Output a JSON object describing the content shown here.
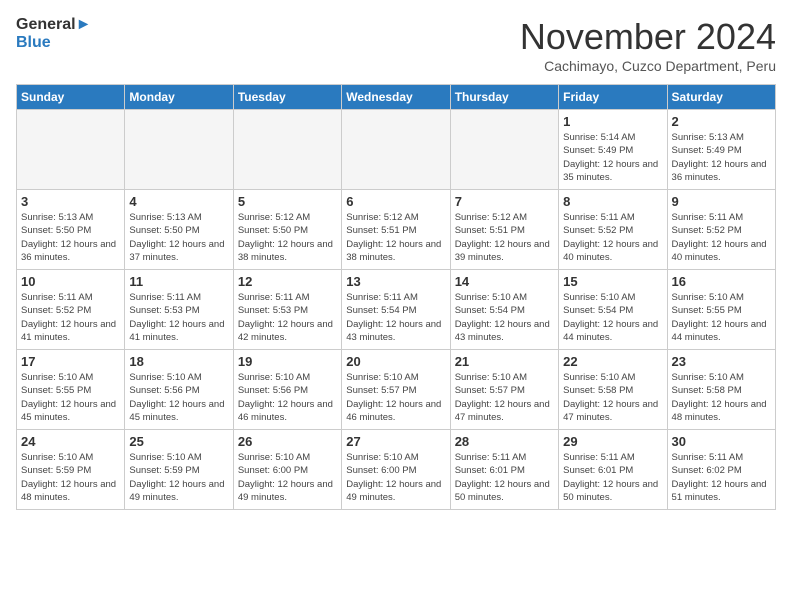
{
  "header": {
    "logo_line1": "General",
    "logo_line2": "Blue",
    "month": "November 2024",
    "location": "Cachimayo, Cuzco Department, Peru"
  },
  "days_of_week": [
    "Sunday",
    "Monday",
    "Tuesday",
    "Wednesday",
    "Thursday",
    "Friday",
    "Saturday"
  ],
  "weeks": [
    [
      {
        "day": "",
        "empty": true
      },
      {
        "day": "",
        "empty": true
      },
      {
        "day": "",
        "empty": true
      },
      {
        "day": "",
        "empty": true
      },
      {
        "day": "",
        "empty": true
      },
      {
        "day": "1",
        "sunrise": "5:14 AM",
        "sunset": "5:49 PM",
        "daylight": "12 hours and 35 minutes."
      },
      {
        "day": "2",
        "sunrise": "5:13 AM",
        "sunset": "5:49 PM",
        "daylight": "12 hours and 36 minutes."
      }
    ],
    [
      {
        "day": "3",
        "sunrise": "5:13 AM",
        "sunset": "5:50 PM",
        "daylight": "12 hours and 36 minutes."
      },
      {
        "day": "4",
        "sunrise": "5:13 AM",
        "sunset": "5:50 PM",
        "daylight": "12 hours and 37 minutes."
      },
      {
        "day": "5",
        "sunrise": "5:12 AM",
        "sunset": "5:50 PM",
        "daylight": "12 hours and 38 minutes."
      },
      {
        "day": "6",
        "sunrise": "5:12 AM",
        "sunset": "5:51 PM",
        "daylight": "12 hours and 38 minutes."
      },
      {
        "day": "7",
        "sunrise": "5:12 AM",
        "sunset": "5:51 PM",
        "daylight": "12 hours and 39 minutes."
      },
      {
        "day": "8",
        "sunrise": "5:11 AM",
        "sunset": "5:52 PM",
        "daylight": "12 hours and 40 minutes."
      },
      {
        "day": "9",
        "sunrise": "5:11 AM",
        "sunset": "5:52 PM",
        "daylight": "12 hours and 40 minutes."
      }
    ],
    [
      {
        "day": "10",
        "sunrise": "5:11 AM",
        "sunset": "5:52 PM",
        "daylight": "12 hours and 41 minutes."
      },
      {
        "day": "11",
        "sunrise": "5:11 AM",
        "sunset": "5:53 PM",
        "daylight": "12 hours and 41 minutes."
      },
      {
        "day": "12",
        "sunrise": "5:11 AM",
        "sunset": "5:53 PM",
        "daylight": "12 hours and 42 minutes."
      },
      {
        "day": "13",
        "sunrise": "5:11 AM",
        "sunset": "5:54 PM",
        "daylight": "12 hours and 43 minutes."
      },
      {
        "day": "14",
        "sunrise": "5:10 AM",
        "sunset": "5:54 PM",
        "daylight": "12 hours and 43 minutes."
      },
      {
        "day": "15",
        "sunrise": "5:10 AM",
        "sunset": "5:54 PM",
        "daylight": "12 hours and 44 minutes."
      },
      {
        "day": "16",
        "sunrise": "5:10 AM",
        "sunset": "5:55 PM",
        "daylight": "12 hours and 44 minutes."
      }
    ],
    [
      {
        "day": "17",
        "sunrise": "5:10 AM",
        "sunset": "5:55 PM",
        "daylight": "12 hours and 45 minutes."
      },
      {
        "day": "18",
        "sunrise": "5:10 AM",
        "sunset": "5:56 PM",
        "daylight": "12 hours and 45 minutes."
      },
      {
        "day": "19",
        "sunrise": "5:10 AM",
        "sunset": "5:56 PM",
        "daylight": "12 hours and 46 minutes."
      },
      {
        "day": "20",
        "sunrise": "5:10 AM",
        "sunset": "5:57 PM",
        "daylight": "12 hours and 46 minutes."
      },
      {
        "day": "21",
        "sunrise": "5:10 AM",
        "sunset": "5:57 PM",
        "daylight": "12 hours and 47 minutes."
      },
      {
        "day": "22",
        "sunrise": "5:10 AM",
        "sunset": "5:58 PM",
        "daylight": "12 hours and 47 minutes."
      },
      {
        "day": "23",
        "sunrise": "5:10 AM",
        "sunset": "5:58 PM",
        "daylight": "12 hours and 48 minutes."
      }
    ],
    [
      {
        "day": "24",
        "sunrise": "5:10 AM",
        "sunset": "5:59 PM",
        "daylight": "12 hours and 48 minutes."
      },
      {
        "day": "25",
        "sunrise": "5:10 AM",
        "sunset": "5:59 PM",
        "daylight": "12 hours and 49 minutes."
      },
      {
        "day": "26",
        "sunrise": "5:10 AM",
        "sunset": "6:00 PM",
        "daylight": "12 hours and 49 minutes."
      },
      {
        "day": "27",
        "sunrise": "5:10 AM",
        "sunset": "6:00 PM",
        "daylight": "12 hours and 49 minutes."
      },
      {
        "day": "28",
        "sunrise": "5:11 AM",
        "sunset": "6:01 PM",
        "daylight": "12 hours and 50 minutes."
      },
      {
        "day": "29",
        "sunrise": "5:11 AM",
        "sunset": "6:01 PM",
        "daylight": "12 hours and 50 minutes."
      },
      {
        "day": "30",
        "sunrise": "5:11 AM",
        "sunset": "6:02 PM",
        "daylight": "12 hours and 51 minutes."
      }
    ]
  ],
  "labels": {
    "sunrise": "Sunrise:",
    "sunset": "Sunset:",
    "daylight": "Daylight:"
  }
}
